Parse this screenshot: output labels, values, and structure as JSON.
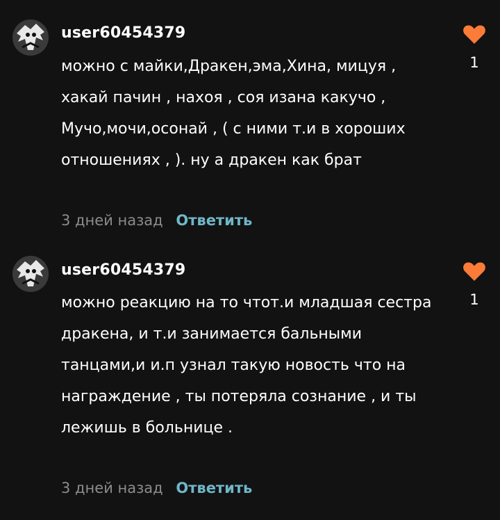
{
  "comments": [
    {
      "username": "user60454379",
      "text": "можно с майки,Дракен,эма,Хина, мицуя , хакай пачин , нахоя , соя изана какучо , Мучо,мочи,осонай , ( с ними т.и в хороших отношениях , ). ну а дракен как брат",
      "time": "3 дней назад",
      "reply": "Ответить",
      "likes": "1"
    },
    {
      "username": "user60454379",
      "text": "можно реакцию на то чтот.и младшая сестра дракена, и т.и занимается бальными танцами,и и.п узнал такую новость что на награждение , ты потеряла сознание , и ты лежишь в больнице .",
      "time": "3 дней назад",
      "reply": "Ответить",
      "likes": "1"
    }
  ],
  "colors": {
    "background": "#121212",
    "heart": "#fb7b38",
    "reply": "#6fb7c8",
    "time": "#8c8c8c"
  },
  "icons": {
    "like": "heart-icon",
    "avatar": "avatar"
  }
}
